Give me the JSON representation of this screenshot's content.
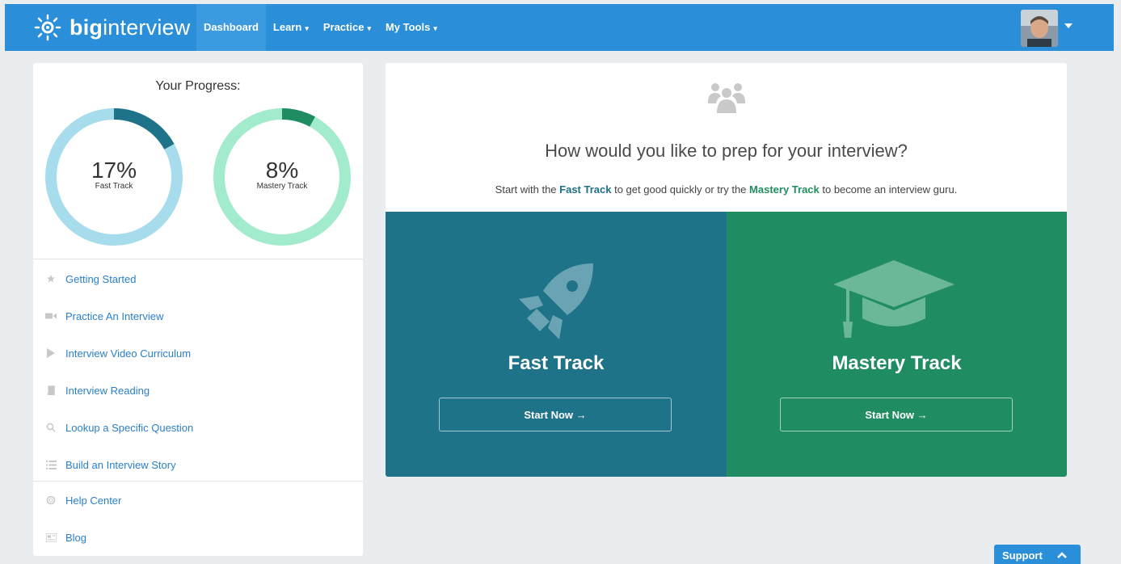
{
  "brand": {
    "bold": "big",
    "light": "interview"
  },
  "nav": [
    {
      "label": "Dashboard",
      "caret": ""
    },
    {
      "label": "Learn",
      "caret": "▾"
    },
    {
      "label": "Practice",
      "caret": "▾"
    },
    {
      "label": "My Tools",
      "caret": "▾"
    }
  ],
  "progress": {
    "title": "Your Progress:",
    "fast": {
      "value": "17%",
      "label": "Fast Track",
      "fraction": 0.17,
      "track_color": "#a6dcec",
      "fill_color": "#1f7389"
    },
    "mastery": {
      "value": "8%",
      "label": "Mastery Track",
      "fraction": 0.08,
      "track_color": "#a2ebcd",
      "fill_color": "#1f8c62"
    }
  },
  "menu": {
    "primary": [
      {
        "label": "Getting Started",
        "icon": "star-icon"
      },
      {
        "label": "Practice An Interview",
        "icon": "video-camera-icon"
      },
      {
        "label": "Interview Video Curriculum",
        "icon": "play-icon"
      },
      {
        "label": "Interview Reading",
        "icon": "book-icon"
      },
      {
        "label": "Lookup a Specific Question",
        "icon": "search-icon"
      },
      {
        "label": "Build an Interview Story",
        "icon": "list-icon"
      }
    ],
    "secondary": [
      {
        "label": "Help Center",
        "icon": "lifebuoy-icon"
      },
      {
        "label": "Blog",
        "icon": "newspaper-icon"
      }
    ]
  },
  "prep": {
    "icon": "group-icon",
    "headline": "How would you like to prep for your interview?",
    "sub_pre": "Start with the ",
    "sub_fast": "Fast Track",
    "sub_mid": " to get good quickly or try the ",
    "sub_mastery": "Mastery Track",
    "sub_post": " to become an interview guru."
  },
  "tracks": {
    "fast": {
      "title": "Fast Track",
      "button": "Start Now →",
      "icon": "rocket-icon"
    },
    "mastery": {
      "title": "Mastery Track",
      "button": "Start Now →",
      "icon": "graduation-cap-icon"
    }
  },
  "support": {
    "label": "Support",
    "icon": "chevron-up-icon"
  },
  "colors": {
    "nav": "#2a8fd8",
    "link": "#2a7fc9",
    "fast": "#1f7389",
    "mastery": "#1f8c62"
  }
}
